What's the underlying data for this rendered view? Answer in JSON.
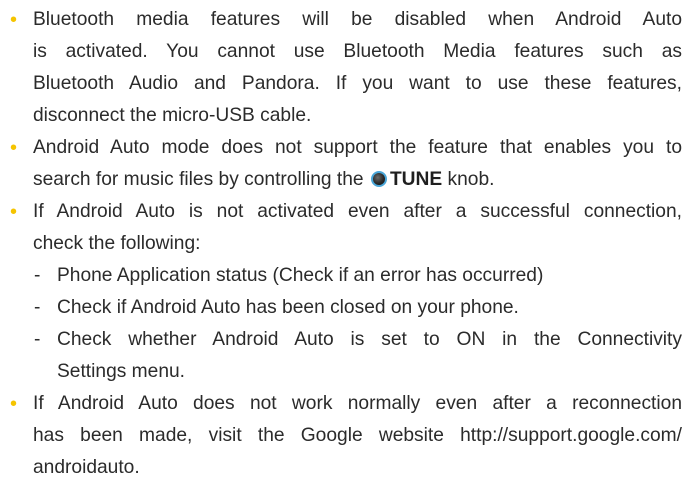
{
  "colors": {
    "bullet": "#f5c400",
    "text": "#2b2b2b",
    "knob_ring": "#4aa6d8"
  },
  "bullet_symbol": "•",
  "dash_symbol": "-",
  "items": [
    {
      "lines": [
        "Bluetooth media features will be disabled when Android Auto",
        "is activated. You cannot use Bluetooth Media features such as",
        "Bluetooth Audio and Pandora. If you want to use these features,",
        "disconnect the micro-USB cable."
      ]
    },
    {
      "lines": [
        "Android Auto mode does not support the feature that enables you to"
      ],
      "line2_before": "search for music files by controlling the",
      "knob_label": "TUNE",
      "line2_after": "knob."
    },
    {
      "lines": [
        "If Android Auto is not activated even after a successful connection,",
        "check the following:"
      ],
      "sub_items": [
        {
          "lines": [
            "Phone Application status (Check if an error has occurred)"
          ]
        },
        {
          "lines": [
            "Check if Android Auto has been closed on your phone."
          ]
        },
        {
          "lines": [
            "Check whether Android Auto is set to ON in the Connectivity",
            "Settings menu."
          ]
        }
      ]
    },
    {
      "lines": [
        "If Android Auto does not work normally even after a reconnection",
        "has been made, visit the Google website http://support.google.com/",
        "androidauto."
      ]
    }
  ]
}
